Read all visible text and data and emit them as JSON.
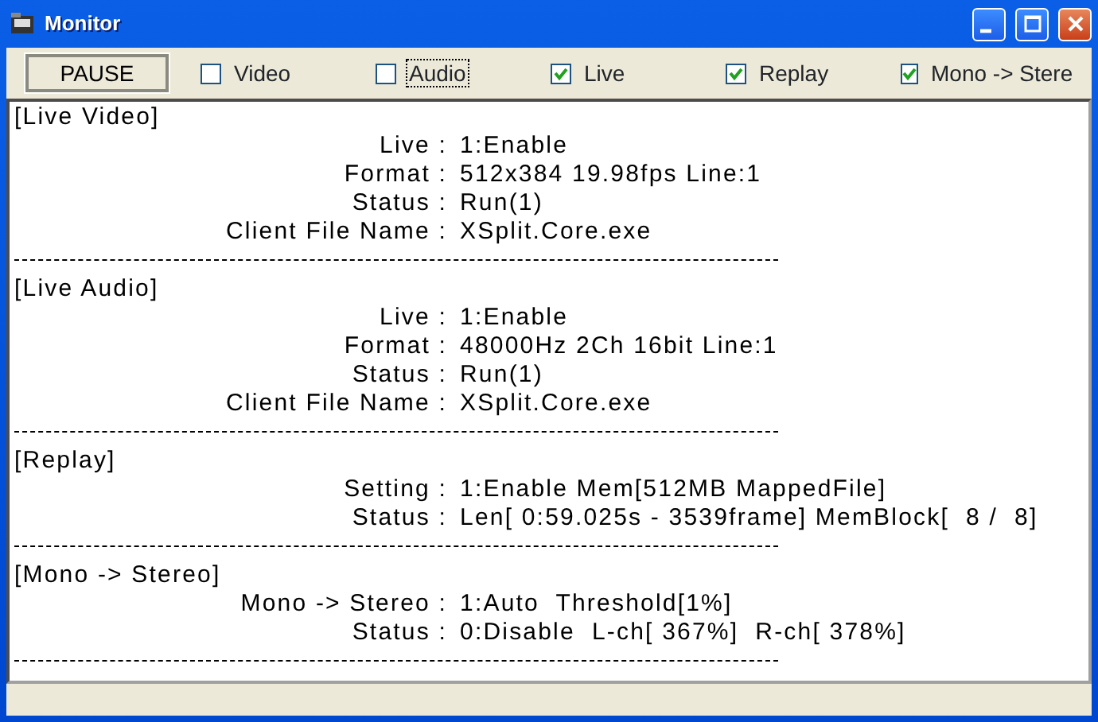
{
  "window": {
    "title": "Monitor"
  },
  "toolbar": {
    "pause_button": "PAUSE",
    "checkboxes": [
      {
        "label": "Video",
        "checked": false,
        "focused": false
      },
      {
        "label": "Audio",
        "checked": false,
        "focused": true
      },
      {
        "label": "Live",
        "checked": true,
        "focused": false
      },
      {
        "label": "Replay",
        "checked": true,
        "focused": false
      },
      {
        "label": "Mono -> Stere",
        "checked": true,
        "focused": false
      }
    ]
  },
  "sections": [
    {
      "heading": "[Live Video]",
      "rows": [
        {
          "label": "Live :",
          "value": "1:Enable"
        },
        {
          "label": "Format :",
          "value": "512x384 19.98fps Line:1"
        },
        {
          "label": "Status :",
          "value": "Run(1)"
        },
        {
          "label": "Client File Name :",
          "value": "XSplit.Core.exe"
        }
      ]
    },
    {
      "heading": "[Live Audio]",
      "rows": [
        {
          "label": "Live :",
          "value": "1:Enable"
        },
        {
          "label": "Format :",
          "value": "48000Hz 2Ch 16bit Line:1"
        },
        {
          "label": "Status :",
          "value": "Run(1)"
        },
        {
          "label": "Client File Name :",
          "value": "XSplit.Core.exe"
        }
      ]
    },
    {
      "heading": "[Replay]",
      "rows": [
        {
          "label": "Setting :",
          "value": "1:Enable Mem[512MB MappedFile]"
        },
        {
          "label": "Status :",
          "value": "Len[ 0:59.025s - 3539frame] MemBlock[  8 /  8]"
        }
      ]
    },
    {
      "heading": "[Mono -> Stereo]",
      "rows": [
        {
          "label": "Mono -> Stereo :",
          "value": "1:Auto  Threshold[1%]"
        },
        {
          "label": "Status :",
          "value": "0:Disable  L-ch[ 367%]  R-ch[ 378%]"
        }
      ]
    }
  ]
}
